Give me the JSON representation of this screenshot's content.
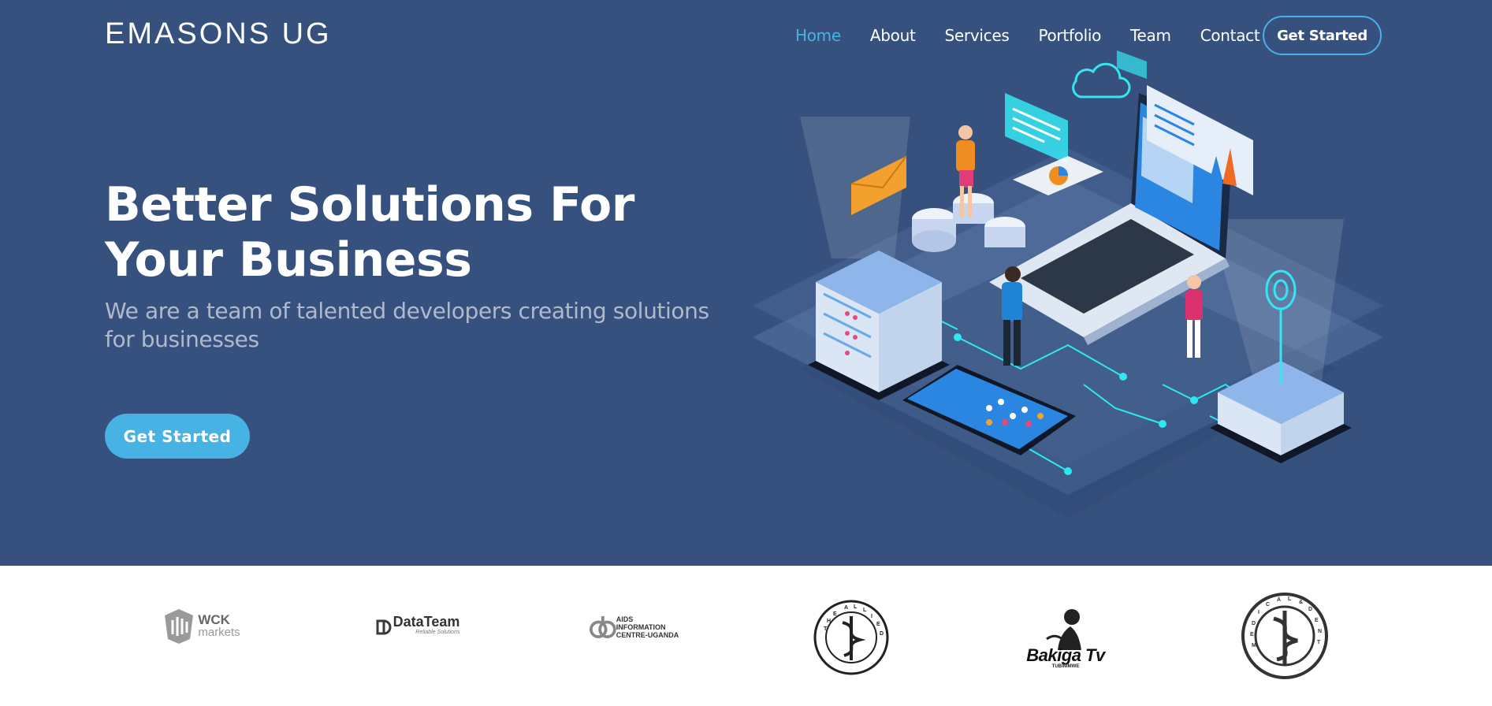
{
  "header": {
    "logo": "EMASONS UG",
    "nav": [
      {
        "label": "Home",
        "active": true
      },
      {
        "label": "About",
        "active": false
      },
      {
        "label": "Services",
        "active": false
      },
      {
        "label": "Portfolio",
        "active": false
      },
      {
        "label": "Team",
        "active": false
      },
      {
        "label": "Contact",
        "active": false
      }
    ],
    "cta": "Get Started"
  },
  "hero": {
    "title": "Better Solutions For Your Business",
    "subtitle": "We are a team of talented developers creating solutions for businesses",
    "cta": "Get Started",
    "illustration_icon": "isometric-tech-illustration"
  },
  "clients": {
    "logos": [
      {
        "name": "wck-markets-logo",
        "line1": "WCK",
        "line2": "markets"
      },
      {
        "name": "datateam-logo",
        "line1": "DataTeam",
        "line2": "Reliable Solutions"
      },
      {
        "name": "aids-information-centre-logo",
        "line1": "AIDS INFORMATION",
        "line2": "CENTRE-UGANDA"
      },
      {
        "name": "allied-health-prof-council-logo",
        "line1": "THE ALLIED HEALTH PROF COUNCIL UGANDA"
      },
      {
        "name": "bakiga-tv-logo",
        "line1": "Bakiga Tv",
        "line2": "TUBINIMWE"
      },
      {
        "name": "medical-dental-practitioners-council-logo",
        "line1": "MEDICAL AND DENTAL PRACTITIONERS COUNCIL"
      }
    ]
  },
  "colors": {
    "hero_bg": "#37517e",
    "accent": "#47b2e4",
    "text_light": "#ffffff"
  }
}
